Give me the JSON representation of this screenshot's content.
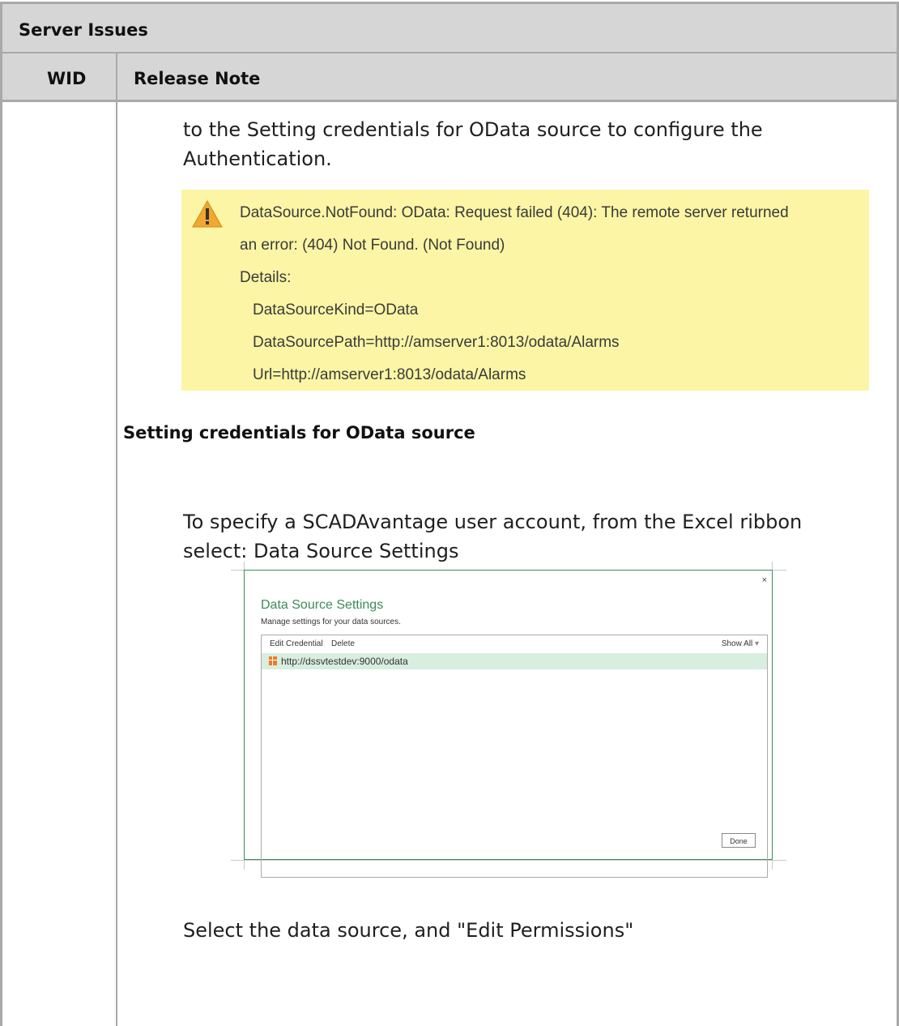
{
  "table": {
    "title": "Server Issues",
    "columns": [
      "WID",
      "Release Note"
    ]
  },
  "content": {
    "intro_line1": "to the Setting credentials for OData source to configure the",
    "intro_line2": "Authentication.",
    "warning": {
      "lines": [
        "DataSource.NotFound: OData: Request failed (404): The remote server returned",
        "an error: (404) Not Found. (Not Found)",
        "Details:",
        "DataSourceKind=OData",
        "DataSourcePath=http://amserver1:8013/odata/Alarms",
        "Url=http://amserver1:8013/odata/Alarms"
      ],
      "icon": "warning-icon",
      "color": "#fbf5a5"
    },
    "heading": "Setting credentials for OData source",
    "para1_line1": "To specify a SCADAvantage user account, from the Excel ribbon",
    "para1_line2": "select: Data Source Settings",
    "dialog": {
      "close": "×",
      "title": "Data Source Settings",
      "subtitle": "Manage settings for your data sources.",
      "edit_credential": "Edit Credential",
      "delete": "Delete",
      "show_label": "Show",
      "show_value": "All",
      "item": "http://dssvtestdev:9000/odata",
      "done": "Done"
    },
    "para2": "Select the data source, and \"Edit Permissions\""
  }
}
